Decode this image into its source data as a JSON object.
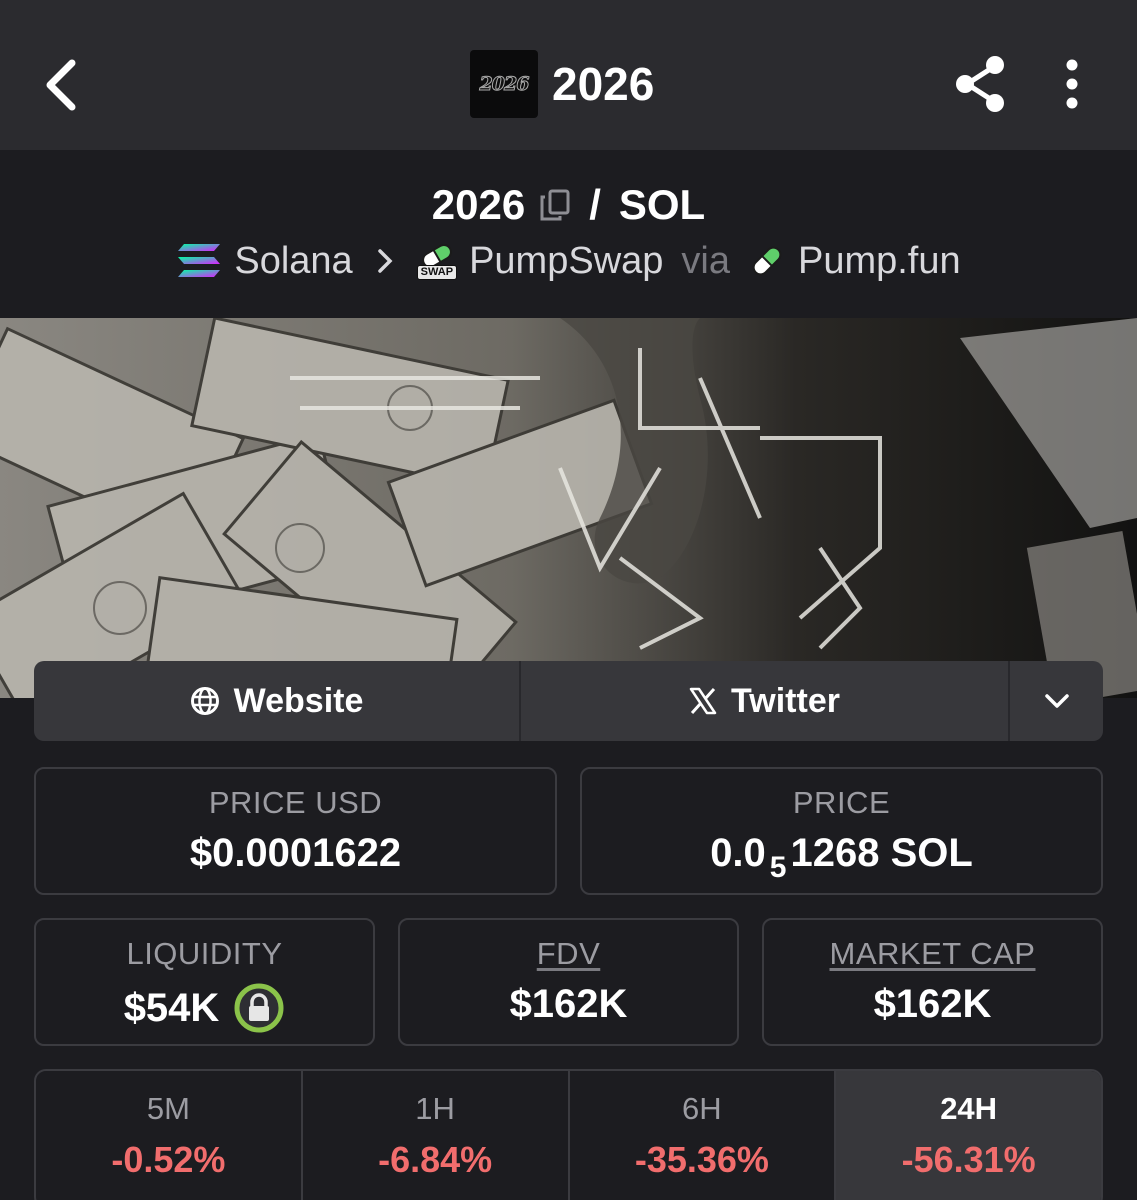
{
  "header": {
    "title": "2026",
    "logo_text": "2026"
  },
  "pair": {
    "base": "2026",
    "separator": "/",
    "quote": "SOL"
  },
  "chain": {
    "network": "Solana",
    "dex": "PumpSwap",
    "dex_badge": "SWAP",
    "via": "via",
    "launchpad": "Pump.fun"
  },
  "links": {
    "website": "Website",
    "twitter": "Twitter"
  },
  "stats": {
    "price_usd_label": "PRICE USD",
    "price_usd": "$0.0001622",
    "price_label": "PRICE",
    "price_prefix": "0.0",
    "price_zeros": "5",
    "price_suffix": "1268 SOL",
    "liquidity_label": "LIQUIDITY",
    "liquidity": "$54K",
    "fdv_label": "FDV",
    "fdv": "$162K",
    "mcap_label": "MARKET CAP",
    "mcap": "$162K"
  },
  "timeframes": [
    {
      "label": "5M",
      "change": "-0.52%"
    },
    {
      "label": "1H",
      "change": "-6.84%"
    },
    {
      "label": "6H",
      "change": "-35.36%"
    },
    {
      "label": "24H",
      "change": "-56.31%"
    }
  ],
  "colors": {
    "negative": "#f16d6d",
    "lock_ring": "#8bc34a",
    "background": "#1c1c20",
    "topbar": "#2b2b2f"
  },
  "icons": [
    "back-arrow-icon",
    "share-icon",
    "more-vertical-icon",
    "copy-icon",
    "solana-icon",
    "chevron-right-icon",
    "pumpswap-icon",
    "pill-icon",
    "globe-icon",
    "x-icon",
    "chevron-down-icon",
    "lock-icon"
  ],
  "banner": "grayscale photo of dollar bills with 2026 line-art overlay"
}
